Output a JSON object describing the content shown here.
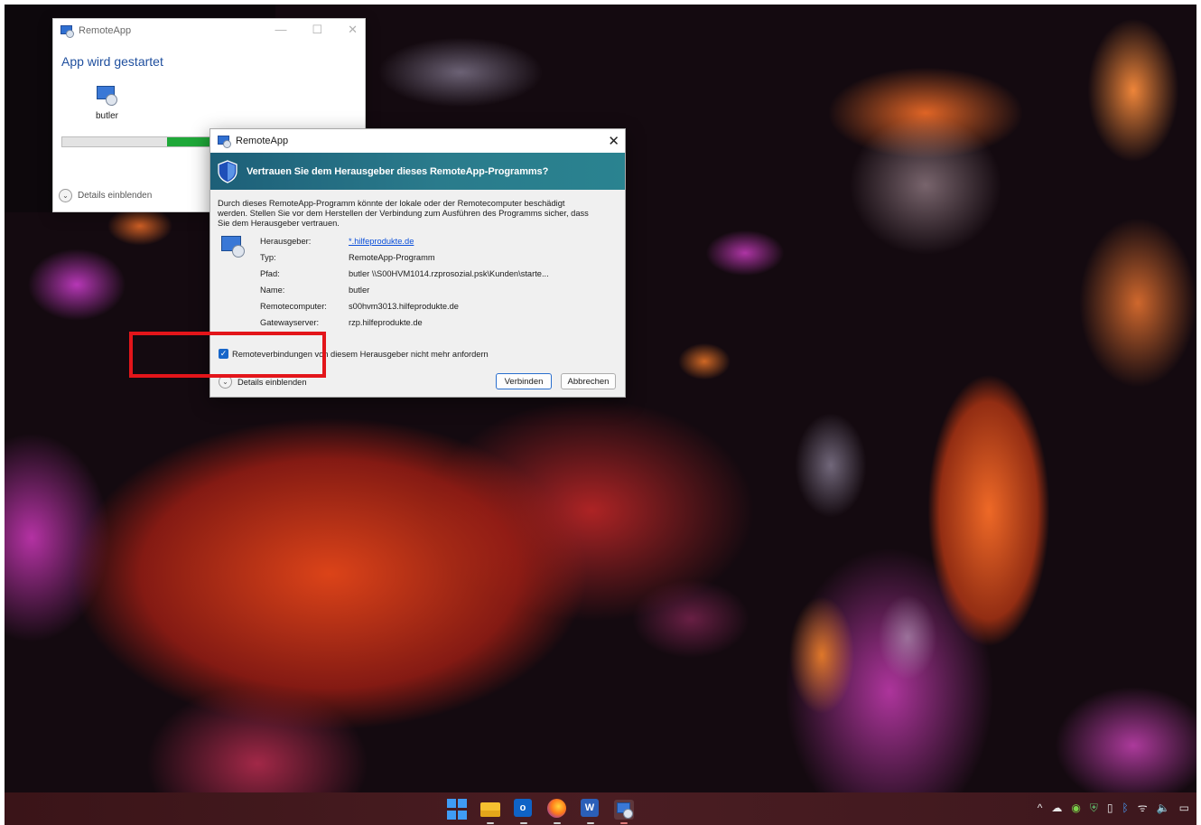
{
  "back_window": {
    "title": "RemoteApp",
    "heading": "App wird gestartet",
    "app_label": "butler",
    "progress_fraction_start": 0.58,
    "progress_fraction_end": 0.85,
    "details_label": "Details einblenden",
    "controls": {
      "minimize": "—",
      "maximize": "☐",
      "close": "✕"
    }
  },
  "dialog": {
    "title": "RemoteApp",
    "close": "✕",
    "banner": "Vertrauen Sie dem Herausgeber dieses RemoteApp-Programms?",
    "description": "Durch dieses RemoteApp-Programm könnte der lokale oder der Remotecomputer beschädigt werden. Stellen Sie vor dem Herstellen der Verbindung zum Ausführen des Programms sicher, dass Sie dem Herausgeber vertrauen.",
    "properties": [
      {
        "label": "Herausgeber:",
        "value": "*.hilfeprodukte.de",
        "link": true
      },
      {
        "label": "Typ:",
        "value": "RemoteApp-Programm"
      },
      {
        "label": "Pfad:",
        "value": "butler \\\\S00HVM1014.rzprosozial.psk\\Kunden\\starte..."
      },
      {
        "label": "Name:",
        "value": "butler"
      },
      {
        "label": "Remotecomputer:",
        "value": "s00hvm3013.hilfeprodukte.de"
      },
      {
        "label": "Gatewayserver:",
        "value": "rzp.hilfeprodukte.de"
      }
    ],
    "checkbox_label": "Remoteverbindungen von diesem Herausgeber nicht mehr anfordern",
    "checkbox_checked": true,
    "details_label": "Details einblenden",
    "connect_button": "Verbinden",
    "cancel_button": "Abbrechen"
  },
  "taskbar": {
    "apps": [
      "start-icon",
      "file-explorer-icon",
      "outlook-icon",
      "firefox-icon",
      "word-icon",
      "remoteapp-icon"
    ],
    "outlook_letter": "o",
    "word_letter": "W",
    "tray": {
      "chevron": "^",
      "cloud": "☁",
      "wifi": "ᯤ",
      "volume": "🔈",
      "bluetooth": "ᛒ"
    }
  },
  "colors": {
    "accent": "#1766c9",
    "banner": "#2a7b8c",
    "highlight_box": "#e3151a",
    "progress": "#1fa839"
  }
}
